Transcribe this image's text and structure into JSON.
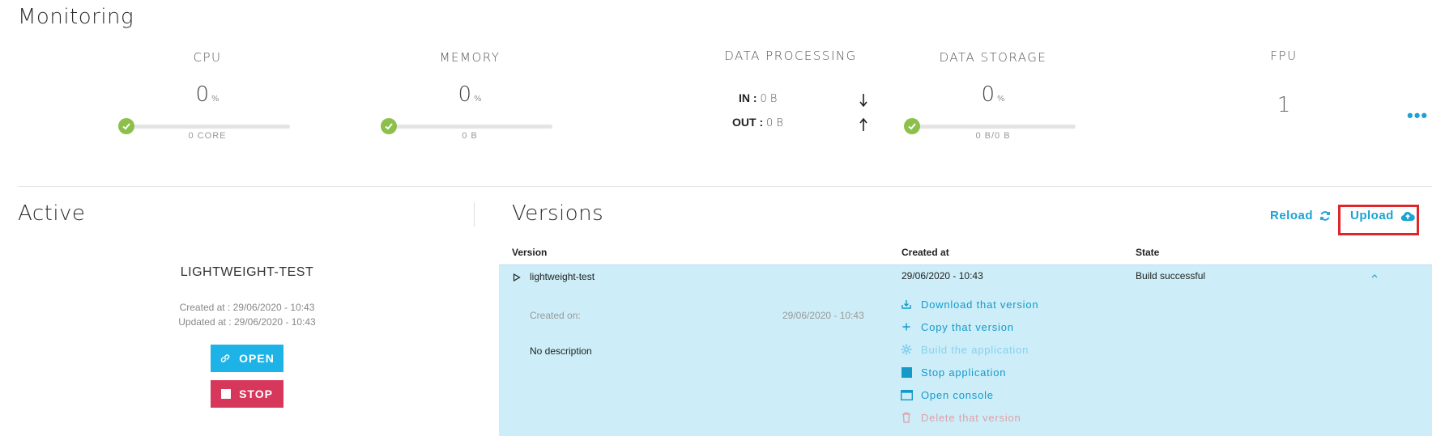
{
  "monitoring": {
    "title": "Monitoring",
    "cpu": {
      "title": "CPU",
      "value": "0",
      "unit": "%",
      "sub": "0 CORE",
      "level": 0
    },
    "memory": {
      "title": "MEMORY",
      "value": "0",
      "unit": "%",
      "sub": "0 B",
      "level": 0
    },
    "data_processing": {
      "title": "DATA PROCESSING",
      "in_label": "IN :",
      "in_value": "0 B",
      "out_label": "OUT :",
      "out_value": "0 B"
    },
    "data_storage": {
      "title": "DATA STORAGE",
      "value": "0",
      "unit": "%",
      "sub": "0 B/0 B",
      "level": 0
    },
    "fpu": {
      "title": "FPU",
      "value": "1"
    }
  },
  "active": {
    "title": "Active",
    "name": "LIGHTWEIGHT-TEST",
    "created": "Created at : 29/06/2020 - 10:43",
    "updated": "Updated at : 29/06/2020 - 10:43",
    "open_label": "OPEN",
    "stop_label": "STOP"
  },
  "versions": {
    "title": "Versions",
    "reload_label": "Reload",
    "upload_label": "Upload",
    "columns": {
      "version": "Version",
      "created_at": "Created at",
      "state": "State"
    },
    "row": {
      "name": "lightweight-test",
      "created_at": "29/06/2020 - 10:43",
      "state": "Build successful",
      "created_on_label": "Created on:",
      "created_on_value": "29/06/2020 - 10:43",
      "description": "No description"
    },
    "actions": {
      "download": "Download that version",
      "copy": "Copy that version",
      "build": "Build the application",
      "stop": "Stop application",
      "console": "Open console",
      "delete": "Delete that version"
    }
  },
  "colors": {
    "accent": "#1ba3d4",
    "ok_green": "#8cc04b",
    "stop_red": "#d6375b",
    "open_blue": "#1eb3e6",
    "row_bg": "#cdeef8",
    "highlight_red": "#e0252a"
  }
}
